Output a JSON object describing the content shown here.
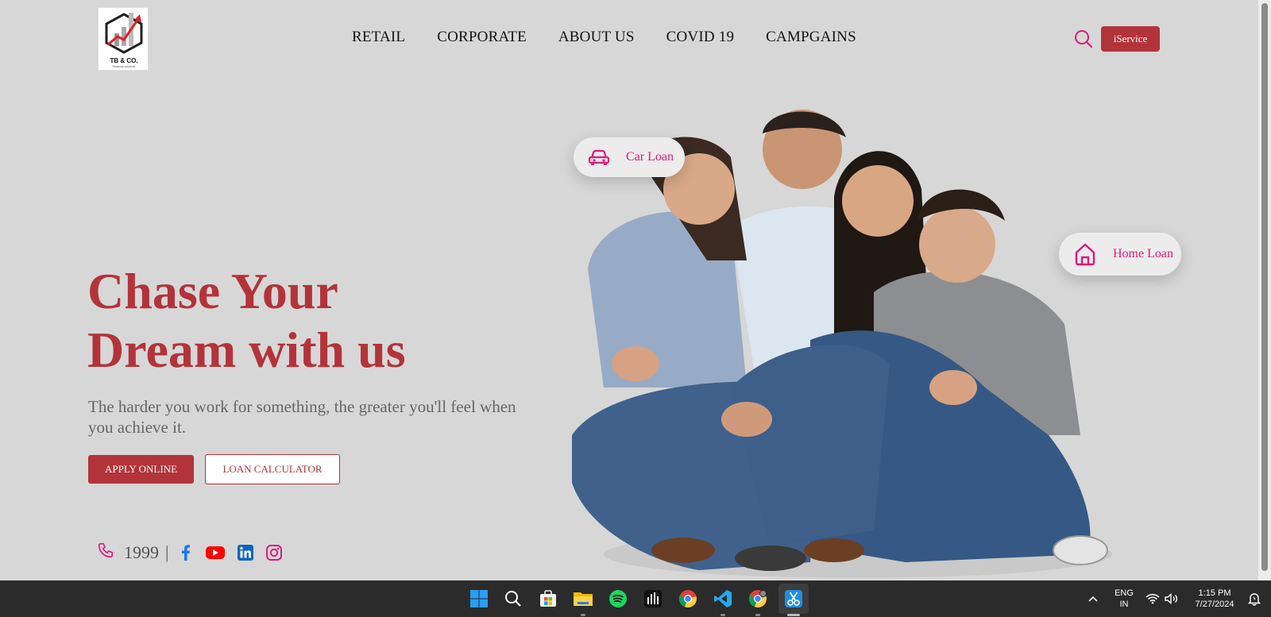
{
  "brand": {
    "logo_text": "TB & CO.",
    "logo_subtext": "Financial solutions",
    "primary_color": "#b3333a",
    "accent_color": "#e0197d"
  },
  "nav": {
    "items": [
      {
        "label": "RETAIL"
      },
      {
        "label": "CORPORATE"
      },
      {
        "label": "ABOUT US"
      },
      {
        "label": "COVID 19"
      },
      {
        "label": "CAMPGAINS"
      }
    ],
    "search_icon": "search-icon",
    "iservice_label": "iService"
  },
  "hero": {
    "title_line1": "Chase Your",
    "title_line2": "Dream with us",
    "subtitle": "The harder you work for something, the greater you'll feel when you achieve it.",
    "apply_label": "APPLY ONLINE",
    "calculator_label": "LOAN CALCULATOR"
  },
  "contact": {
    "phone": "1999",
    "separator": "|",
    "social": [
      "facebook-icon",
      "youtube-icon",
      "linkedin-icon",
      "instagram-icon"
    ]
  },
  "badges": {
    "car_loan": "Car Loan",
    "home_loan": "Home Loan"
  },
  "taskbar": {
    "language": "ENG",
    "region": "IN",
    "time": "1:15 PM",
    "date": "7/27/2024"
  }
}
